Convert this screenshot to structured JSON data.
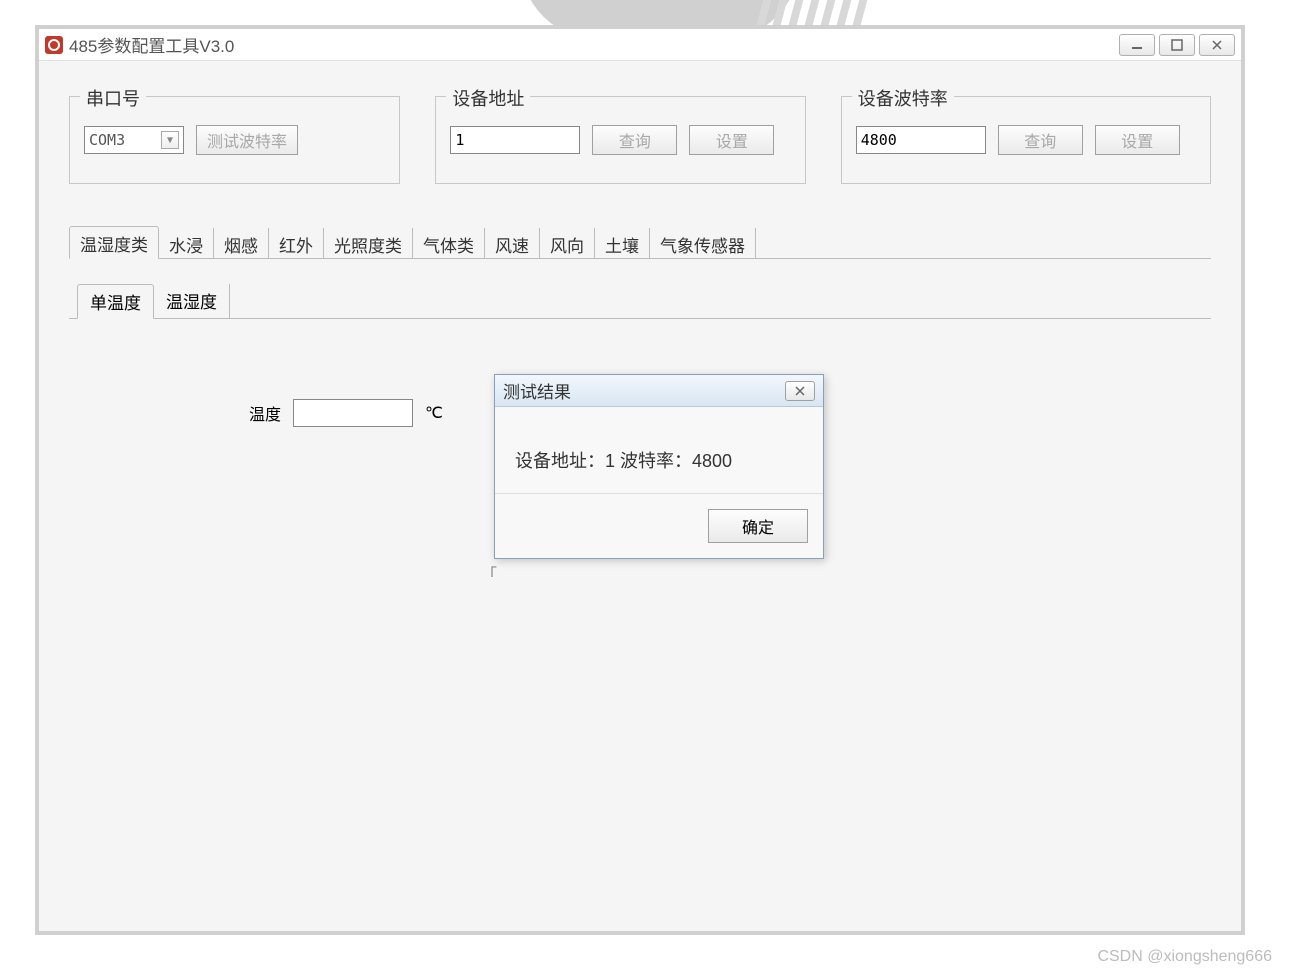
{
  "window": {
    "title": "485参数配置工具V3.0"
  },
  "fieldsets": {
    "serial": {
      "legend": "串口号",
      "combo_value": "COM3",
      "test_btn": "测试波特率"
    },
    "addr": {
      "legend": "设备地址",
      "value": "1",
      "query_btn": "查询",
      "set_btn": "设置"
    },
    "baud": {
      "legend": "设备波特率",
      "value": "4800",
      "query_btn": "查询",
      "set_btn": "设置"
    }
  },
  "tabs": {
    "main": [
      "温湿度类",
      "水浸",
      "烟感",
      "红外",
      "光照度类",
      "气体类",
      "风速",
      "风向",
      "土壤",
      "气象传感器"
    ],
    "sub": [
      "单温度",
      "温湿度"
    ]
  },
  "content": {
    "temp_label": "温度",
    "temp_unit": "℃"
  },
  "dialog": {
    "title": "测试结果",
    "message": "设备地址：1  波特率：4800",
    "ok": "确定"
  },
  "watermark": "CSDN @xiongsheng666"
}
